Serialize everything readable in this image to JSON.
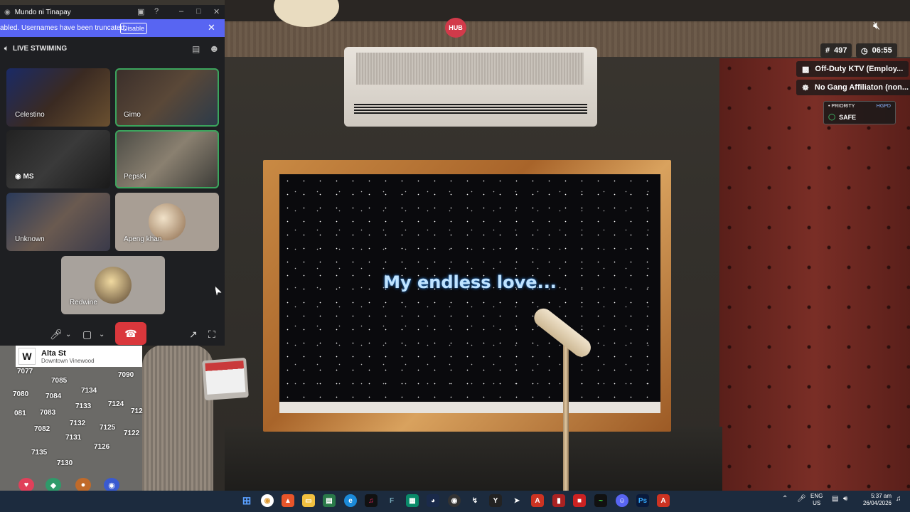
{
  "discord": {
    "window_title": "Mundo ni Tinapay",
    "notice_text": "abled. Usernames have been truncated.",
    "notice_button": "Disable",
    "channel_name": "LIVE STWIMING",
    "participants": [
      {
        "name": "Celestino"
      },
      {
        "name": "Gimo"
      },
      {
        "name": "MS"
      },
      {
        "name": "PepsKi"
      },
      {
        "name": "Unknown"
      },
      {
        "name": "Apeng khan"
      },
      {
        "name": "Redwine"
      }
    ]
  },
  "game": {
    "lyric": "My endless love...",
    "hud": {
      "player_count": "497",
      "time": "06:55",
      "job": "Off-Duty KTV (Employ...",
      "gang": "No Gang Affiliaton (non...",
      "priority_label": "PRIORITY",
      "priority_dept": "HGPD",
      "priority_status": "SAFE"
    },
    "location": {
      "street": "Alta St",
      "zone": "Downtown Vinewood",
      "compass": "W",
      "map_labels": [
        "7077",
        "7085",
        "7090",
        "7080",
        "7084",
        "7134",
        "081",
        "7083",
        "7133",
        "7124",
        "712",
        "7082",
        "7132",
        "7125",
        "7122",
        "7131",
        "7126",
        "7135",
        "7130"
      ]
    }
  },
  "taskbar": {
    "lang_top": "ENG",
    "lang_bottom": "US",
    "clock_time": "5:37 am",
    "clock_date": "26/04/2026"
  },
  "colors": {
    "discord_blurple": "#5865f2",
    "hangup_red": "#da373c",
    "speaking_green": "#3ba55d"
  }
}
